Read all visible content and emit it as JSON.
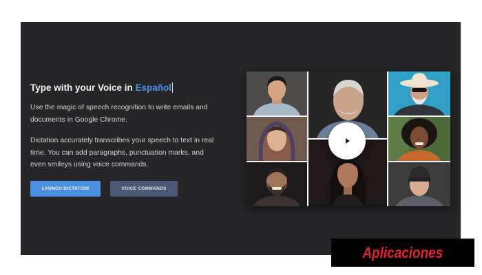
{
  "hero": {
    "title_prefix": "Type with your Voice in ",
    "title_language": "Español",
    "paragraph_1": "Use the magic of speech recognition to write emails and documents in Google Chrome.",
    "paragraph_2": "Dictation accurately transcribes your speech to text in real time. You can add paragraphs, punctuation marks, and even smileys using voice commands.",
    "launch_label": "LAUNCH DICTATION",
    "commands_label": "VOICE COMMANDS"
  },
  "video": {
    "play_icon": "play-icon",
    "tiles": [
      "man-glasses-portrait",
      "young-man-portrait",
      "elderly-man-portrait",
      "woman-headscarf-portrait",
      "woman-curly-hair-portrait",
      "bearded-man-portrait",
      "woman-dark-hair-portrait",
      "man-beanie-portrait"
    ]
  },
  "watermark": {
    "text": "Aplicaciones"
  },
  "colors": {
    "accent": "#4a8fe0",
    "secondary_button": "#4b5873",
    "card_bg": "#262628",
    "watermark_text": "#e4202f"
  }
}
